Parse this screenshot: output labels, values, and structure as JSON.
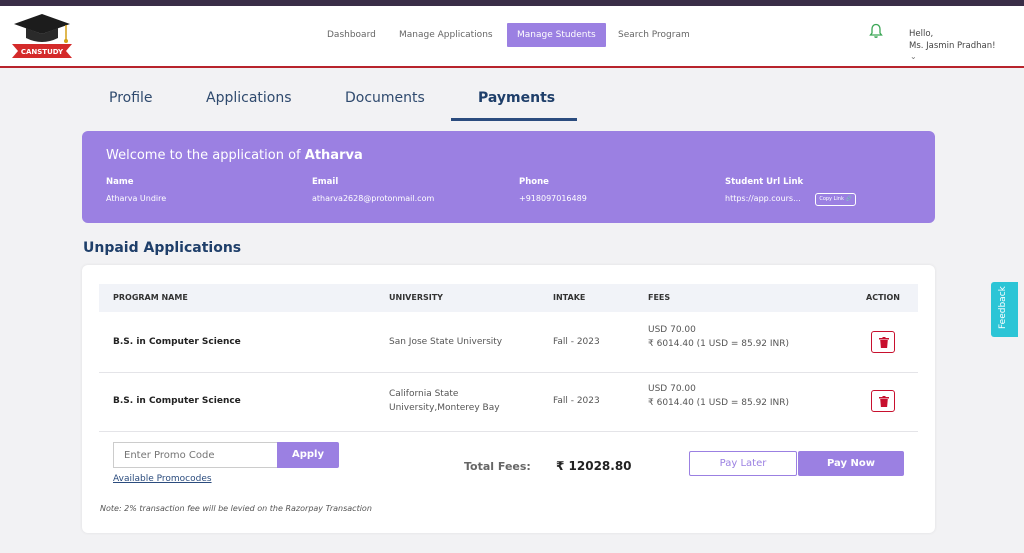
{
  "brand": {
    "logo_text": "CANSTUDY"
  },
  "nav": [
    {
      "label": "Dashboard"
    },
    {
      "label": "Manage Applications"
    },
    {
      "label": "Manage Students"
    },
    {
      "label": "Search Program"
    }
  ],
  "user": {
    "greeting": "Hello,",
    "name": "Ms. Jasmin Pradhan!"
  },
  "tabs": [
    {
      "label": "Profile"
    },
    {
      "label": "Applications"
    },
    {
      "label": "Documents"
    },
    {
      "label": "Payments"
    }
  ],
  "banner": {
    "welcome_prefix": "Welcome to the application of",
    "student_name": "Atharva",
    "fields": [
      {
        "label": "Name",
        "value": "Atharva Undire"
      },
      {
        "label": "Email",
        "value": "atharva2628@protonmail.com"
      },
      {
        "label": "Phone",
        "value": "+918097016489"
      },
      {
        "label": "Student Url Link",
        "value": "https://app.cours..."
      }
    ],
    "copy_label": "Copy Link"
  },
  "section_title": "Unpaid Applications",
  "table": {
    "headers": [
      "PROGRAM NAME",
      "UNIVERSITY",
      "INTAKE",
      "FEES",
      "ACTION"
    ],
    "rows": [
      {
        "program": "B.S. in Computer Science",
        "university": "San Jose State University",
        "intake": "Fall - 2023",
        "fee_usd": "USD 70.00",
        "fee_inr": "₹ 6014.40 (1 USD = 85.92 INR)"
      },
      {
        "program": "B.S. in Computer Science",
        "university": "California State University,Monterey Bay",
        "intake": "Fall - 2023",
        "fee_usd": "USD 70.00",
        "fee_inr": "₹ 6014.40 (1 USD = 85.92 INR)"
      }
    ]
  },
  "promo": {
    "placeholder": "Enter Promo Code",
    "apply_label": "Apply",
    "link_label": "Available Promocodes"
  },
  "totals": {
    "label": "Total Fees:",
    "value": "₹ 12028.80"
  },
  "buttons": {
    "pay_later": "Pay Later",
    "pay_now": "Pay Now"
  },
  "note": "Note: 2% transaction fee will be levied on the Razorpay Transaction",
  "feedback_label": "Feedback",
  "colors": {
    "accent": "#9b80e2",
    "navy": "#1f3f6a",
    "danger": "#c8102e",
    "feedback": "#2cc5d6"
  }
}
